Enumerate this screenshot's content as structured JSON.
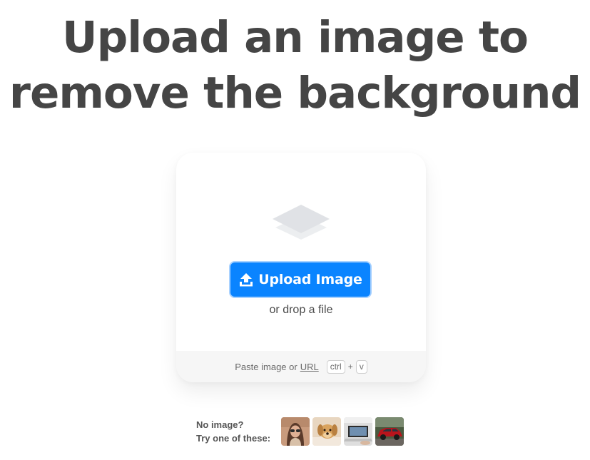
{
  "hero": {
    "title_line1": "Upload an image to",
    "title_line2": "remove the background"
  },
  "upload_card": {
    "icon": "layers-icon",
    "button_icon": "upload-icon",
    "button_label": "Upload Image",
    "drop_text": "or drop a file",
    "paste_prefix": "Paste image or",
    "paste_url": "URL",
    "kbd_ctrl": "ctrl",
    "kbd_plus": "+",
    "kbd_v": "v"
  },
  "samples": {
    "label_line1": "No image?",
    "label_line2": "Try one of these:",
    "thumbnails": [
      {
        "subject": "woman-with-sunglasses"
      },
      {
        "subject": "dog"
      },
      {
        "subject": "laptop"
      },
      {
        "subject": "red-car"
      }
    ]
  },
  "colors": {
    "title": "#454545",
    "button": "#0a84ff",
    "button_ring": "#a9d2ff",
    "icon_gray": "#e3e5e8",
    "paste_bar": "#f6f6f6"
  }
}
